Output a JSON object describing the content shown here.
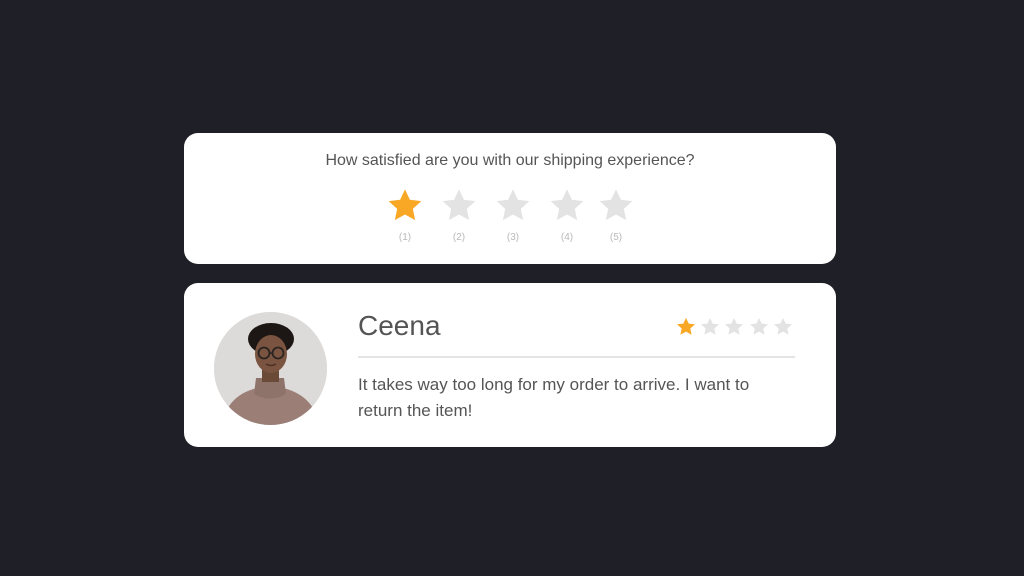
{
  "survey": {
    "question": "How satisfied are you with our shipping experience?",
    "selected_rating": 1,
    "max_rating": 5,
    "options": [
      {
        "caption": "(1)",
        "selected": true
      },
      {
        "caption": "(2)",
        "selected": false
      },
      {
        "caption": "(3)",
        "selected": false
      },
      {
        "caption": "(4)",
        "selected": false
      },
      {
        "caption": "(5)",
        "selected": false
      }
    ]
  },
  "review": {
    "name": "Ceena",
    "rating": 1,
    "max_rating": 5,
    "text": "It takes way too long for my order to arrive. I want to return the item!"
  },
  "colors": {
    "background": "#1f1f27",
    "card": "#ffffff",
    "star_active": "#f9a825",
    "star_inactive": "#e3e3e3",
    "text_primary": "#555555"
  },
  "icons": {
    "star": "star-icon",
    "avatar": "person-avatar"
  }
}
